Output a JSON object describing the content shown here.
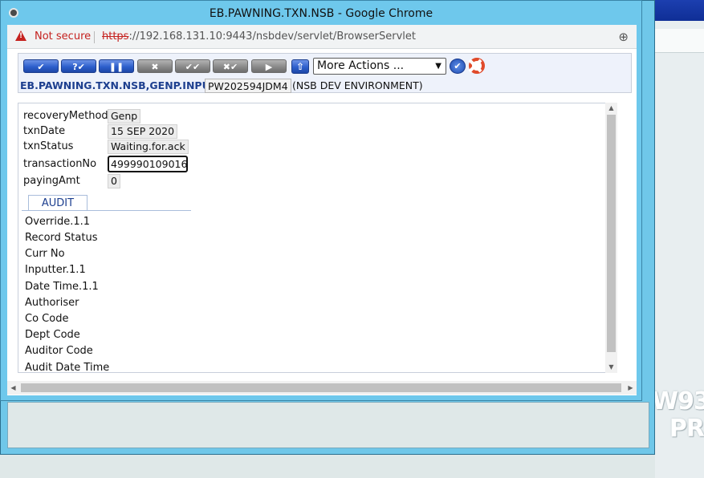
{
  "window": {
    "title": "EB.PAWNING.TXN.NSB - Google Chrome"
  },
  "address_bar": {
    "security_label": "Not secure",
    "url_scheme": "https",
    "url_rest": "://192.168.131.10:9443/nsbdev/servlet/BrowserServlet"
  },
  "toolbar": {
    "buttons": [
      {
        "icon": "check-icon",
        "glyph": "✔",
        "state": "enabled"
      },
      {
        "icon": "validate-icon",
        "glyph": "?✔",
        "state": "enabled"
      },
      {
        "icon": "hold-icon",
        "glyph": "❚❚",
        "state": "enabled"
      },
      {
        "icon": "delete-icon",
        "glyph": "✖",
        "state": "disabled"
      },
      {
        "icon": "authorise-icon",
        "glyph": "✔✔",
        "state": "disabled"
      },
      {
        "icon": "reverse-icon",
        "glyph": "✖✔",
        "state": "disabled"
      },
      {
        "icon": "next-icon",
        "glyph": "▶",
        "state": "disabled"
      }
    ],
    "more_actions_label": "More Actions ...",
    "go_glyph": "✔",
    "up_glyph": "⇧"
  },
  "transaction": {
    "application": "EB.PAWNING.TXN.NSB,GENP.INPUT",
    "id": "PW202594JDM4",
    "environment": "(NSB DEV ENVIRONMENT)"
  },
  "fields": [
    {
      "label": "recoveryMethod",
      "value": "Genp"
    },
    {
      "label": "txnDate",
      "value": "15 SEP 2020"
    },
    {
      "label": "txnStatus",
      "value": "Waiting.for.ack"
    },
    {
      "label": "transactionNo",
      "value": "499990109016"
    },
    {
      "label": "payingAmt",
      "value": "0"
    }
  ],
  "audit": {
    "tab_label": "AUDIT",
    "items": [
      "Override.1.1",
      "Record Status",
      "Curr No",
      "Inputter.1.1",
      "Date Time.1.1",
      "Authoriser",
      "Co Code",
      "Dept Code",
      "Auditor Code",
      "Audit Date Time"
    ]
  },
  "background": {
    "watermark_line1": "W93",
    "watermark_line2": "PR"
  },
  "colors": {
    "title_bar": "#6ec8ec",
    "not_secure": "#c5221f",
    "app_name": "#1d3f8f"
  }
}
